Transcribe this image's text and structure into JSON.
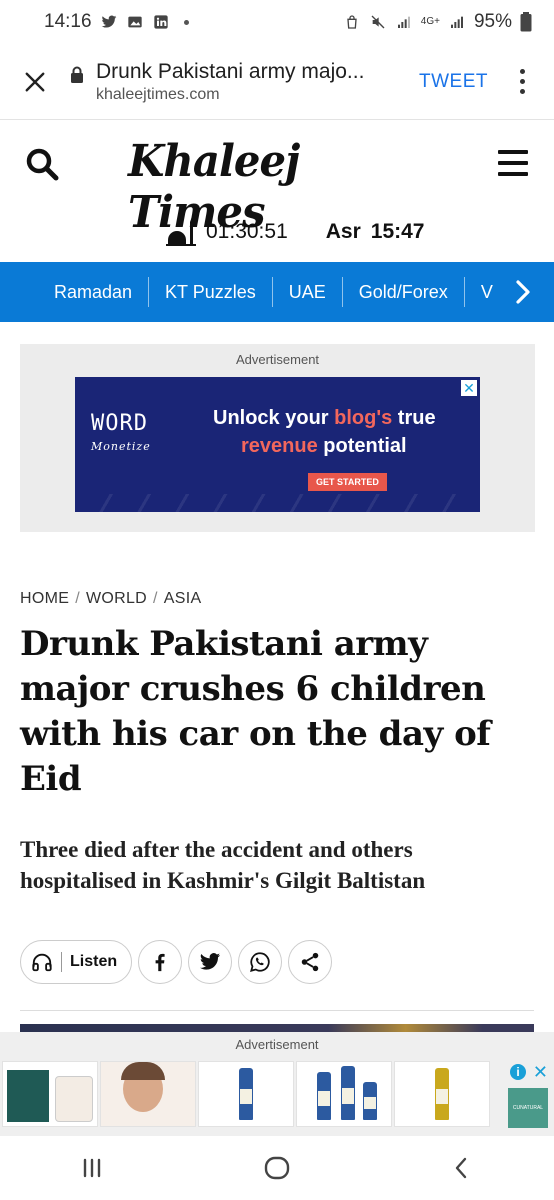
{
  "status_bar": {
    "time": "14:16",
    "network": "4G+",
    "battery": "95%"
  },
  "browser": {
    "page_title": "Drunk Pakistani army majo...",
    "url": "khaleejtimes.com",
    "tweet_label": "TWEET"
  },
  "site": {
    "logo": "Khaleej Times",
    "countdown": "01:30:51",
    "prayer_name": "Asr",
    "prayer_time": "15:47"
  },
  "nav": {
    "items": [
      "Ramadan",
      "KT Puzzles",
      "UAE",
      "Gold/Forex",
      "V"
    ]
  },
  "top_ad": {
    "label": "Advertisement",
    "brand": "WORD",
    "brand_sub": "Monetize",
    "line1_pre": "Unlock your ",
    "line1_hl": "blog's",
    "line1_post": " true",
    "line2_hl": "revenue",
    "line2_post": " potential",
    "cta": "GET STARTED",
    "close": "✕"
  },
  "article": {
    "breadcrumb": [
      "HOME",
      "WORLD",
      "ASIA"
    ],
    "headline": "Drunk Pakistani army major crushes 6 children with his car on the day of Eid",
    "subhead": "Three died after the accident and others hospitalised in Kashmir's Gilgit Baltistan",
    "listen_label": "Listen"
  },
  "bottom_ad": {
    "label": "Advertisement",
    "card_text": "CUNATURAL"
  },
  "colors": {
    "nav_blue": "#0a7ad6",
    "ad_navy": "#1a2576",
    "ad_coral": "#f2675c",
    "link_blue": "#1a73e8"
  }
}
